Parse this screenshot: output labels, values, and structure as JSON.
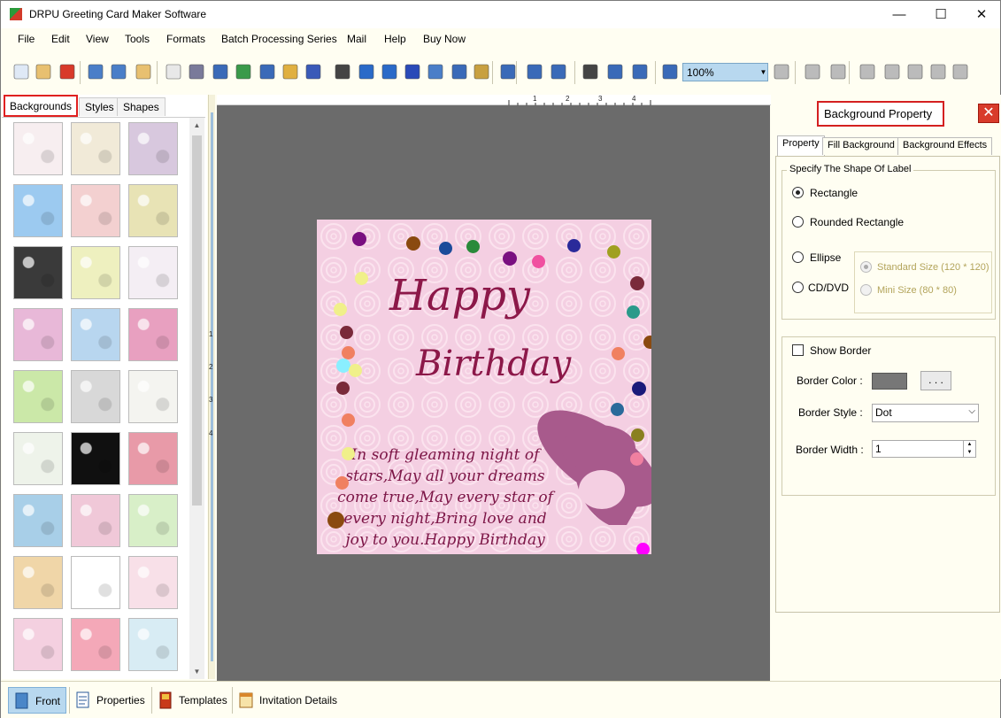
{
  "window": {
    "title": "DRPU Greeting Card Maker Software",
    "minimize": "—",
    "maximize": "☐",
    "close": "✕"
  },
  "menu": [
    "File",
    "Edit",
    "View",
    "Tools",
    "Formats",
    "Batch Processing Series",
    "Mail",
    "Help",
    "Buy Now"
  ],
  "toolbar": {
    "zoom_value": "100%",
    "icons": [
      "new-icon",
      "open-icon",
      "close-file-icon",
      "save-icon",
      "save-as-icon",
      "export-icon",
      "properties-icon",
      "print-icon",
      "print-preview-icon",
      "image-icon",
      "pen-icon",
      "picture-icon",
      "barcode-w-icon",
      "barcode-icon",
      "text-icon",
      "font-a-icon",
      "s-text-icon",
      "mail-icon",
      "line-icon",
      "database-icon",
      "undo-icon",
      "redo-icon",
      "grid-icon",
      "actual-size-icon",
      "fit-icon",
      "zoom-in-icon",
      "zoom-out-icon",
      "lock-icon",
      "unlock-icon",
      "arrow-left-icon",
      "flip-icon",
      "arrow-right-icon",
      "arrow-up-icon",
      "align-icon",
      "arrow-down-icon"
    ]
  },
  "left_panel": {
    "tabs": [
      "Backgrounds",
      "Styles",
      "Shapes"
    ],
    "active_tab": "Backgrounds",
    "thumbnails": [
      [
        "#f7eef0",
        "#f1ead8",
        "#d8c8de"
      ],
      [
        "#9ccaf0",
        "#f3d0d0",
        "#e8e3b5"
      ],
      [
        "#3a3a3a",
        "#eef0bf",
        "#f4eef4"
      ],
      [
        "#e8b8d8",
        "#b8d6ef",
        "#e8a0c0"
      ],
      [
        "#cbe8a8",
        "#d8d8d8",
        "#f4f4f0"
      ],
      [
        "#eef3ea",
        "#101010",
        "#e89aa8"
      ],
      [
        "#a8cfe8",
        "#f0c8d8",
        "#d8efc8"
      ],
      [
        "#f0d6a8",
        "#ffffff",
        "#f8e0e8"
      ],
      [
        "#f4d0e0",
        "#f4a8b8",
        "#d8ecf4"
      ]
    ]
  },
  "canvas": {
    "ruler_marks": [
      "1",
      "2",
      "3",
      "4"
    ],
    "card": {
      "line1": "Happy",
      "line2": "Birthday",
      "verse": "In soft gleaming night of stars,May all your dreams come true,May every star of every night,Bring love and joy to you.Happy Birthday",
      "background": "#f4cfe2",
      "text_color": "#8c1849"
    }
  },
  "right_panel": {
    "title": "Background Property",
    "tabs": [
      "Property",
      "Fill Background",
      "Background Effects"
    ],
    "active_tab": "Property",
    "shape_group_label": "Specify The Shape Of Label",
    "shapes": [
      "Rectangle",
      "Rounded Rectangle",
      "Ellipse",
      "CD/DVD"
    ],
    "selected_shape": "Rectangle",
    "sizes": [
      "Standard Size (120 * 120)",
      "Mini Size (80 * 80)"
    ],
    "show_border_label": "Show Border",
    "border_color_label": "Border Color :",
    "border_color_button": ". . .",
    "border_style_label": "Border Style :",
    "border_style_value": "Dot",
    "border_width_label": "Border Width :",
    "border_width_value": "1"
  },
  "bottom_bar": [
    "Front",
    "Properties",
    "Templates",
    "Invitation Details"
  ]
}
